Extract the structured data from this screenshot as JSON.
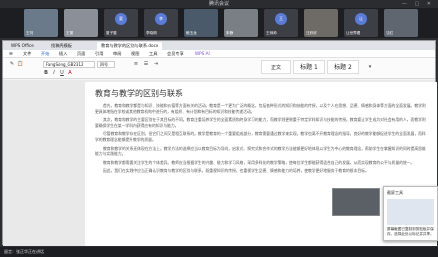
{
  "meeting": {
    "title": "腾讯会议",
    "window_controls": "— ▢ ✕"
  },
  "participants": [
    {
      "name": "王刘",
      "type": "cam",
      "color": "#6b7a8a"
    },
    {
      "name": "王丽",
      "type": "cam",
      "color": "#8a8f98"
    },
    {
      "name": "夏子墨",
      "type": "avatar",
      "initial": "夏"
    },
    {
      "name": "李晓明",
      "type": "avatar",
      "initial": "李"
    },
    {
      "name": "鲍玉龙",
      "type": "cam",
      "color": "#4a5a6a"
    },
    {
      "name": "朱静",
      "type": "cam",
      "color": "#7a7f86"
    },
    {
      "name": "王帅帅",
      "type": "avatar",
      "initial": "王"
    },
    {
      "name": "汪欣欣",
      "type": "cam",
      "color": "#6e6a66"
    },
    {
      "name": "让世界看",
      "type": "avatar",
      "initial": "让"
    },
    {
      "name": "沈红",
      "type": "cam",
      "color": "#5f6670"
    }
  ],
  "app": {
    "tabs": [
      "WPS Office",
      "找稿壳模板",
      "教育与教学的区别与联系.docx"
    ],
    "menus": [
      "文件",
      "开始",
      "插入",
      "页面",
      "引用",
      "审阅",
      "视图",
      "工具",
      "会员专享",
      "WPS AI"
    ],
    "active_menu": "开始",
    "font_name": "FangSong_GB2312",
    "font_size": "四号",
    "styles": [
      "正文",
      "标题 1",
      "标题 2"
    ]
  },
  "document": {
    "title": "教育与教学的区别与联系",
    "paragraphs": [
      "首先，教育和教学都是与知识、技能和价值等方面有关的活动。教育是一个更为广泛的概念，包括各种形式的知识和技能的传授，以及个人在思想、品德、情感和身体等方面的全面发展。教学则更具体地指在学校或其他教育机构中进行的，有组织、有计划和有目标的知识和技能传递活动。",
      "其次，教育和教学的主要区别在于其目标的不同。教育注重培养学生的全面素质和终身学习的能力，而教学则更侧重于特定学科知识与技能的传授。教育要让学生成为对社会有用的人，而教学则要确保学生在某一学科内获得应有的知识与能力。",
      "尽管教育和教学存在区别，但它们之间又是相互联系的。教学是教育的一个重要组成部分，教育需要通过教学来实现，教学也离不开教育理念的指导。良好的教学能够促进学生的全面发展，而科学的教育理念能够提升教学的质量。",
      "教育和教学的关系还体现在方法上。教学方法的选择应当以教育目标为导向，启发式、探究式和合作式的教学方法能够更好地体现以学生为中心的教育理念，帮助学生在掌握知识的同时提高思维能力与实践能力。",
      "教育和教学都需要关注学生的个体差异。教师应当根据学生的兴趣、能力和学习风格，采用多样化的教学策略，使每位学生都能获得适合自己的发展，从而实现教育的公平与质量的统一。",
      "因此，我们在实践中应当正确认识教育与教学的区别与联系，既重视知识的传授，也重视学生品德、情感和能力的培养，使教学更好地服务于教育的根本目标。"
    ]
  },
  "taskbar": {
    "label": "留言：张正华正在讲话"
  },
  "popup": {
    "header": "截屏工具",
    "text": "屏幕截图已复制到剪贴板并保存。选择此处以标记并共享。"
  },
  "colors": {
    "accent": "#1e64c8",
    "meeting_bg": "#1d1e22"
  }
}
